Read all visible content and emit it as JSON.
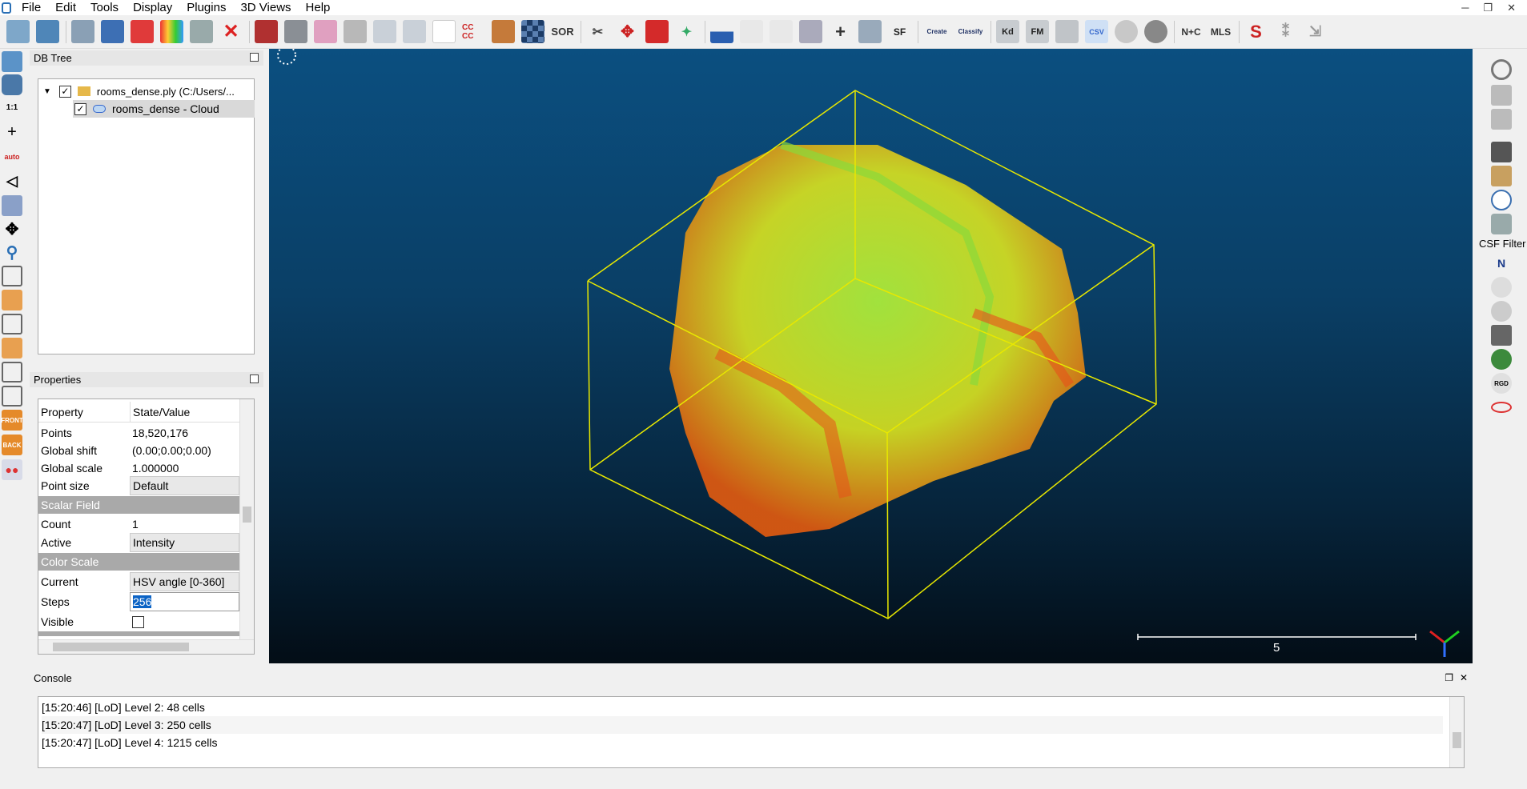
{
  "menu": [
    "File",
    "Edit",
    "Tools",
    "Display",
    "Plugins",
    "3D Views",
    "Help"
  ],
  "toolbar_labels": {
    "cccc": "CC CC",
    "sor": "SOR",
    "sf": "SF",
    "canupo_create": "Create",
    "canupo_classify": "Classify",
    "kd": "Kd",
    "fm": "FM",
    "csv": "CSV",
    "nc": "N+C",
    "mls": "MLS"
  },
  "left_labels": {
    "one_to_one": "1:1",
    "auto": "auto",
    "front": "FRONT",
    "back": "BACK"
  },
  "right_labels": {
    "csf_filter": "CSF Filter",
    "n": "N",
    "rgd": "RGD"
  },
  "dbtree": {
    "title": "DB Tree",
    "file": "rooms_dense.ply (C:/Users/...",
    "cloud": "rooms_dense - Cloud"
  },
  "properties": {
    "title": "Properties",
    "col_property": "Property",
    "col_value": "State/Value",
    "points_k": "Points",
    "points_v": "18,520,176",
    "shift_k": "Global shift",
    "shift_v": "(0.00;0.00;0.00)",
    "scale_k": "Global scale",
    "scale_v": "1.000000",
    "psize_k": "Point size",
    "psize_v": "Default",
    "sec_sf": "Scalar Field",
    "count_k": "Count",
    "count_v": "1",
    "active_k": "Active",
    "active_v": "Intensity",
    "sec_cs": "Color Scale",
    "current_k": "Current",
    "current_v": "HSV angle [0-360]",
    "steps_k": "Steps",
    "steps_v": "256",
    "visible_k": "Visible"
  },
  "view": {
    "scale_label": "5"
  },
  "console": {
    "title": "Console",
    "lines": [
      "[15:20:46] [LoD] Level 2: 48 cells",
      "[15:20:47] [LoD] Level 3: 250 cells",
      "[15:20:47] [LoD] Level 4: 1215 cells"
    ]
  },
  "colors": {
    "bbox": "#e8e800",
    "sky_top": "#0b4f80",
    "sky_bottom": "#030d16"
  }
}
